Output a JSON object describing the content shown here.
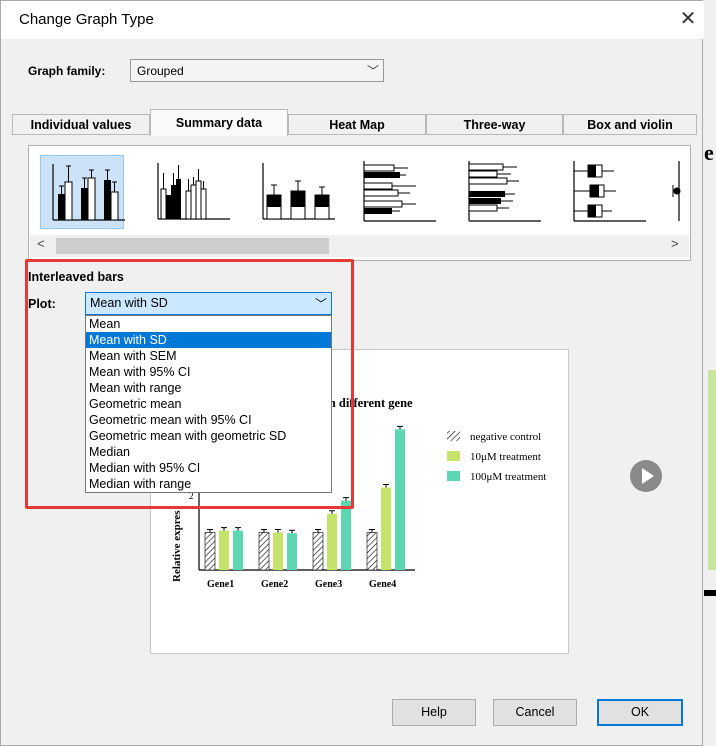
{
  "dialog": {
    "title": "Change Graph Type",
    "graph_family_label": "Graph family:",
    "graph_family_value": "Grouped",
    "tabs": [
      {
        "label": "Individual values",
        "active": false
      },
      {
        "label": "Summary data",
        "active": true
      },
      {
        "label": "Heat Map",
        "active": false
      },
      {
        "label": "Three-way",
        "active": false
      },
      {
        "label": "Box and violin",
        "active": false
      }
    ],
    "graph_type_label": "Interleaved bars",
    "plot_label": "Plot:",
    "plot_value": "Mean with SD",
    "plot_options": [
      "Mean",
      "Mean with SD",
      "Mean with SEM",
      "Mean with 95% CI",
      "Mean with range",
      "Geometric mean",
      "Geometric mean with 95% CI",
      "Geometric mean with geometric SD",
      "Median",
      "Median with 95% CI",
      "Median with range"
    ],
    "plot_selected_index": 1,
    "buttons": {
      "help": "Help",
      "cancel": "Cancel",
      "ok": "OK"
    }
  },
  "preview": {
    "title_fragment": "at on different gene",
    "ylabel_fragment": "Relative expres",
    "legend": [
      "negative control",
      "10μM treatment",
      "100μM treatment"
    ],
    "categories": [
      "Gene1",
      "Gene2",
      "Gene3",
      "Gene4"
    ],
    "ytick_visible": "2",
    "colors": {
      "control": "#ffffff",
      "treat10": "#c5e36b",
      "treat100": "#5fd6b3"
    }
  },
  "icons": {
    "close": "close-icon",
    "chevron": "chevron-down-icon",
    "play": "play-icon",
    "scroll_left": "chevron-left-icon",
    "scroll_right": "chevron-right-icon"
  },
  "chart_data": {
    "type": "bar",
    "categories": [
      "Gene1",
      "Gene2",
      "Gene3",
      "Gene4"
    ],
    "series": [
      {
        "name": "negative control",
        "values": [
          1.0,
          1.0,
          1.0,
          1.0
        ]
      },
      {
        "name": "10μM treatment",
        "values": [
          1.05,
          1.0,
          1.5,
          2.2
        ]
      },
      {
        "name": "100μM treatment",
        "values": [
          1.05,
          0.98,
          1.85,
          3.75
        ]
      }
    ],
    "ylabel": "Relative expres",
    "ylim": [
      0,
      4
    ]
  }
}
